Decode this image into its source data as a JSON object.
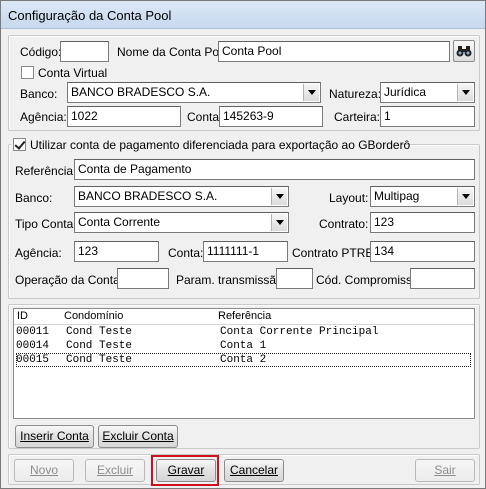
{
  "window": {
    "title": "Configuração da Conta Pool"
  },
  "top": {
    "codigo_label": "Código:",
    "codigo_value": "",
    "nome_label": "Nome da Conta Pool:",
    "nome_value": "Conta Pool",
    "search_icon": "binoculars-icon",
    "conta_virtual_label": "Conta Virtual",
    "conta_virtual_checked": false,
    "banco_label": "Banco:",
    "banco_value": "BANCO BRADESCO S.A.",
    "natureza_label": "Natureza:",
    "natureza_value": "Jurídica",
    "agencia_label": "Agência:",
    "agencia_value": "1022",
    "conta_label": "Conta:",
    "conta_value": "145263-9",
    "carteira_label": "Carteira:",
    "carteira_value": "1"
  },
  "pagamento": {
    "group_label": "Utilizar conta de pagamento diferenciada para exportação ao GBorderô",
    "group_checked": true,
    "referencia_label": "Referência:",
    "referencia_value": "Conta de Pagamento",
    "banco_label": "Banco:",
    "banco_value": "BANCO BRADESCO S.A.",
    "layout_label": "Layout:",
    "layout_value": "Multipag",
    "tipo_conta_label": "Tipo Conta:",
    "tipo_conta_value": "Conta Corrente",
    "contrato_label": "Contrato:",
    "contrato_value": "123",
    "agencia_label": "Agência:",
    "agencia_value": "123",
    "conta_label": "Conta:",
    "conta_value": "1111111-1",
    "contrato_ptrb_label": "Contrato PTRB:",
    "contrato_ptrb_value": "134",
    "operacao_label": "Operação da Conta:",
    "operacao_value": "",
    "param_label": "Param. transmissão:",
    "param_value": "",
    "compromisso_label": "Cód. Compromisso:",
    "compromisso_value": ""
  },
  "list": {
    "columns": [
      "ID",
      "Condomínio",
      "Referência"
    ],
    "rows": [
      {
        "id": "00011",
        "condominio": "Cond Teste",
        "referencia": "Conta Corrente Principal"
      },
      {
        "id": "00014",
        "condominio": "Cond Teste",
        "referencia": "Conta 1"
      },
      {
        "id": "00015",
        "condominio": "Cond Teste",
        "referencia": "Conta 2"
      }
    ],
    "inserir_label": "Inserir Conta",
    "excluir_label": "Excluir Conta"
  },
  "footer": {
    "novo": "Novo",
    "excluir": "Excluir",
    "gravar": "Gravar",
    "cancelar": "Cancelar",
    "sair": "Sair"
  },
  "colors": {
    "highlight": "#d0101a",
    "titlebar": "#c7d9ee"
  }
}
